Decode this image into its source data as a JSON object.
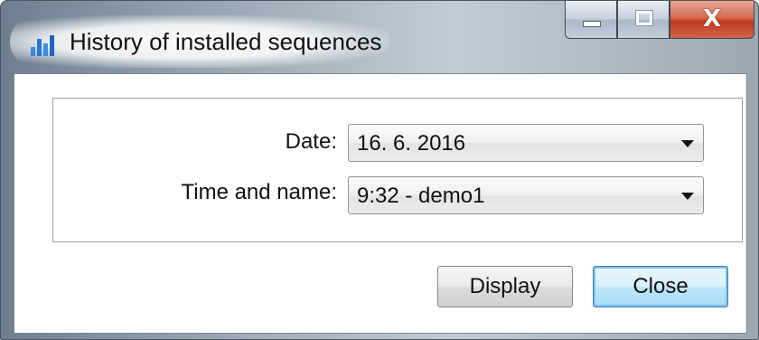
{
  "window": {
    "title": "History of installed sequences",
    "app_icon": "bar-chart-icon",
    "caption_buttons": {
      "minimize_icon": "minimize-icon",
      "maximize_icon": "maximize-icon",
      "close_icon": "close-icon",
      "close_glyph": "X"
    }
  },
  "form": {
    "date_label": "Date:",
    "date_value": "16. 6. 2016",
    "time_label": "Time and name:",
    "time_value": "9:32 - demo1"
  },
  "buttons": {
    "display_label": "Display",
    "close_label": "Close"
  },
  "colors": {
    "close_button": "#c0391f",
    "default_button_border": "#3c7fb1"
  }
}
